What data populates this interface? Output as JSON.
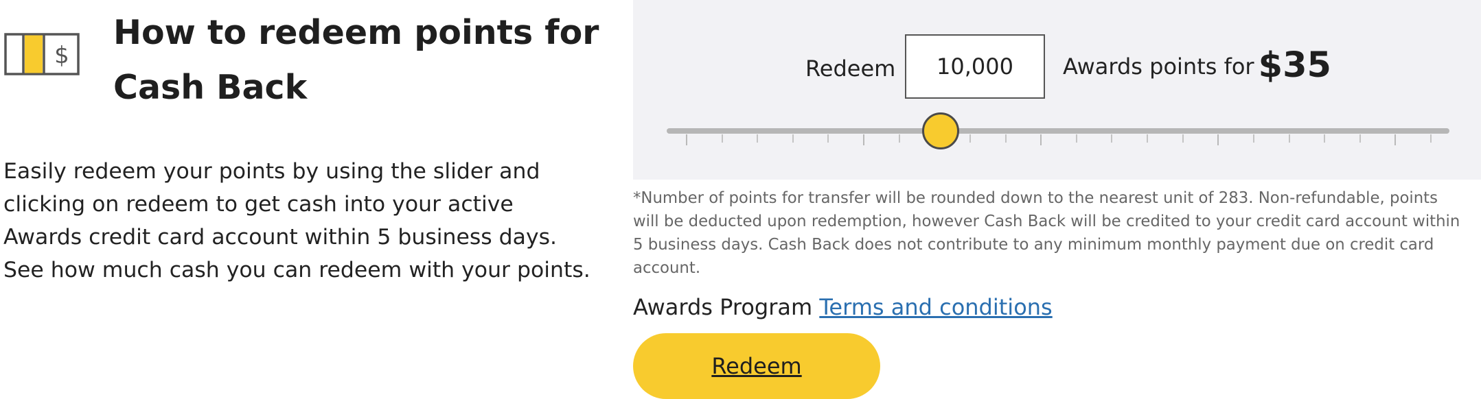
{
  "header": {
    "icon": "cash-bill-icon",
    "title": "How to redeem points for Cash Back"
  },
  "intro": {
    "text": "Easily redeem your points by using the slider and clicking on redeem to get cash into your active Awards credit card account within 5 business days. See how much cash you can redeem with your points."
  },
  "calculator": {
    "redeem_label": "Redeem",
    "points_value": "10,000",
    "awards_text": "Awards points for",
    "cash_amount": "$35",
    "slider_level": 0.35,
    "tick_count": 22
  },
  "disclaimer": "*Number of points for transfer will be rounded down to the nearest unit of 283. Non-refundable, points will be deducted upon redemption, however Cash Back will be credited to your credit card account within 5 business days. Cash Back does not contribute to any minimum monthly payment due on credit card account.",
  "terms": {
    "prefix": "Awards Program",
    "link_text": "Terms and conditions"
  },
  "redeem_button": {
    "label": "Redeem"
  },
  "colors": {
    "accent_yellow": "#f8cb2e",
    "link_blue": "#2a6fb0",
    "panel_bg": "#f2f2f5"
  }
}
